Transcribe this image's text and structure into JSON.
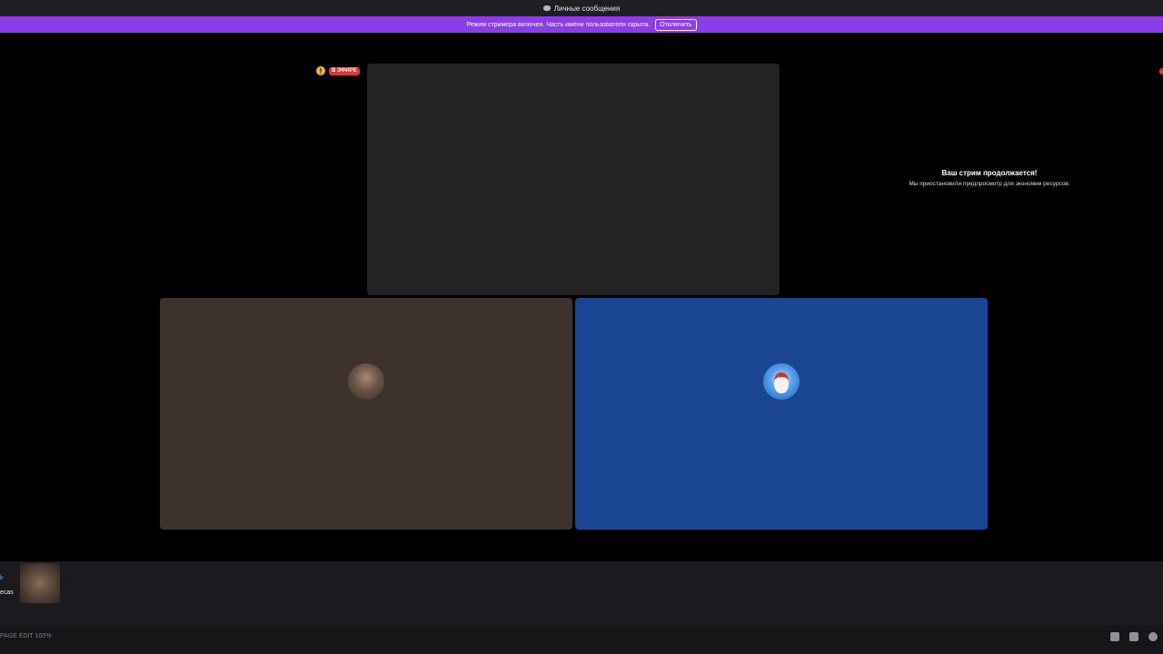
{
  "window": {
    "title": "Личные сообщения"
  },
  "banner": {
    "message": "Режим стримера включен. Часть имени пользователя скрыта.",
    "disable_label": "Отключить"
  },
  "stream": {
    "live_label": "В ЭФИРЕ",
    "warning_glyph": "!",
    "paused_title": "Ваш стрим продолжается!",
    "paused_subtitle": "Мы приостановили предпросмотр для экономии ресурсов."
  },
  "participant": {
    "name_fragment": "k",
    "status_fragment": "ecas"
  },
  "statusbar": {
    "text": "PAGE EDIT 100%"
  },
  "colors": {
    "banner": "#8c3ce8",
    "live": "#da373c",
    "tile_user1": "#3e322d",
    "tile_user2": "#1a4590",
    "tile_stream": "#232325"
  },
  "icons": [
    "discord-icon",
    "warning-icon",
    "avatar",
    "chat-icon",
    "gamepad-icon",
    "settings-icon"
  ]
}
